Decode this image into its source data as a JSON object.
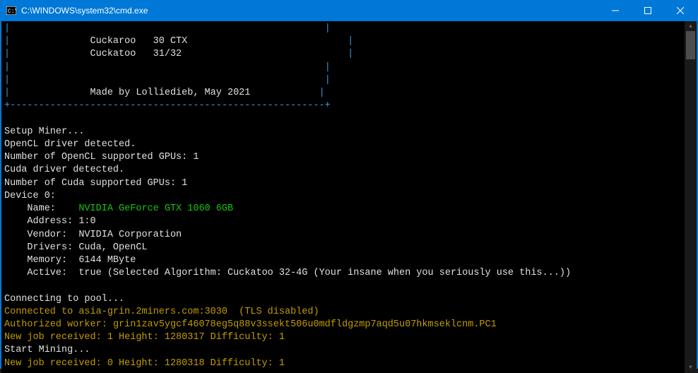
{
  "window": {
    "title": "C:\\WINDOWS\\system32\\cmd.exe"
  },
  "banner": {
    "line1_algo": "Cuckaroo",
    "line1_val": "30 CTX",
    "line2_algo": "Cuckatoo",
    "line2_val": "31/32",
    "credit": "Made by Lolliedieb, May 2021"
  },
  "setup": {
    "l1": "Setup Miner...",
    "l2": "OpenCL driver detected.",
    "l3": "Number of OpenCL supported GPUs: 1",
    "l4": "Cuda driver detected.",
    "l5": "Number of Cuda supported GPUs: 1",
    "l6": "Device 0:"
  },
  "device": {
    "name_label": "Name:",
    "name_value": "NVIDIA GeForce GTX 1060 6GB",
    "address_label": "Address:",
    "address_value": "1:0",
    "vendor_label": "Vendor:",
    "vendor_value": "NVIDIA Corporation",
    "drivers_label": "Drivers:",
    "drivers_value": "Cuda, OpenCL",
    "memory_label": "Memory:",
    "memory_value": "6144 MByte",
    "active_label": "Active:",
    "active_value": "true (Selected Algorithm: Cuckatoo 32-4G (Your insane when you seriously use this...))"
  },
  "pool": {
    "connecting": "Connecting to pool...",
    "connected_prefix": "Connected to ",
    "connected_host": "asia-grin.2miners.com:3030",
    "connected_suffix": "  (TLS disabled)",
    "auth_prefix": "Authorized worker: ",
    "auth_value": "grin1zav5ygcf46078eg5q88v3ssekt506u0mdfldgzmp7aqd5u07hkmseklcnm.PC1",
    "job1": "New job received: 1 Height: 1280317 Difficulty: 1",
    "start": "Start Mining...",
    "job2": "New job received: 0 Height: 1280318 Difficulty: 1"
  }
}
